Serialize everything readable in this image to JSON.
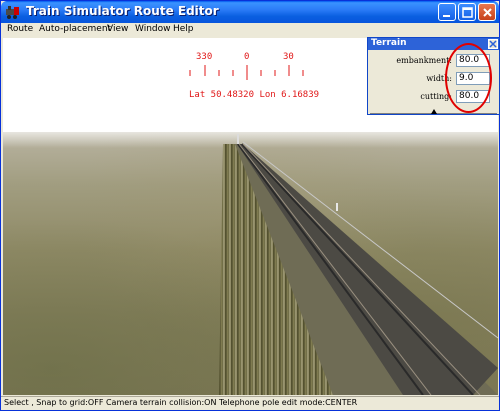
{
  "window": {
    "title": "Train Simulator Route Editor"
  },
  "menu": {
    "items": [
      "Route",
      "Auto-placement",
      "View",
      "Window",
      "Help"
    ]
  },
  "compass": {
    "labels": [
      "330",
      "0",
      "30"
    ],
    "coordinates": "Lat 50.48320  Lon 6.16839"
  },
  "terrain_panel": {
    "title": "Terrain",
    "fields": [
      {
        "label": "embankment:",
        "value": "80.0"
      },
      {
        "label": "width:",
        "value": "9.0"
      },
      {
        "label": "cutting:",
        "value": "80.0"
      }
    ]
  },
  "status": {
    "text": "Select , Snap to grid:OFF Camera terrain collision:ON Telephone pole edit mode:CENTER"
  },
  "colors": {
    "title_bar": "#0a5fe0",
    "accent_red": "#e01818",
    "annotation_circle": "#e00000"
  },
  "icons": [
    "train-icon",
    "minimize-icon",
    "maximize-icon",
    "close-icon"
  ]
}
